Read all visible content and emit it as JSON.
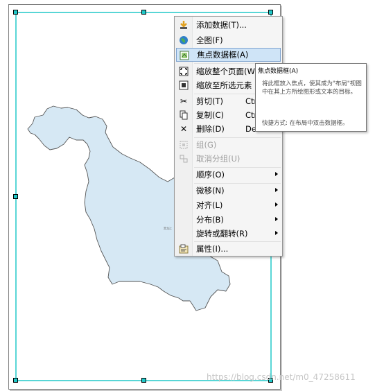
{
  "menu": {
    "items": [
      {
        "label": "添加数据(T)...",
        "icon": "add-data-icon",
        "shortcut": "",
        "disabled": false,
        "submenu": false,
        "highlighted": false
      },
      {
        "label": "全图(F)",
        "icon": "globe-icon",
        "shortcut": "",
        "disabled": false,
        "submenu": false,
        "highlighted": false
      },
      {
        "label": "焦点数据框(A)",
        "icon": "focus-frame-icon",
        "shortcut": "",
        "disabled": false,
        "submenu": false,
        "highlighted": true
      },
      {
        "label": "缩放整个页面(W",
        "icon": "zoom-page-icon",
        "shortcut": "",
        "disabled": false,
        "submenu": false,
        "highlighted": false
      },
      {
        "label": "缩放至所选元素",
        "icon": "zoom-selected-icon",
        "shortcut": "",
        "disabled": false,
        "submenu": false,
        "highlighted": false
      },
      {
        "label": "剪切(T)",
        "icon": "scissors-icon",
        "shortcut": "Ctr",
        "disabled": false,
        "submenu": false,
        "highlighted": false
      },
      {
        "label": "复制(C)",
        "icon": "copy-icon",
        "shortcut": "Ctr",
        "disabled": false,
        "submenu": false,
        "highlighted": false
      },
      {
        "label": "删除(D)",
        "icon": "delete-icon",
        "shortcut": "De",
        "disabled": false,
        "submenu": false,
        "highlighted": false
      },
      {
        "label": "组(G)",
        "icon": "group-icon",
        "shortcut": "",
        "disabled": true,
        "submenu": false,
        "highlighted": false
      },
      {
        "label": "取消分组(U)",
        "icon": "ungroup-icon",
        "shortcut": "",
        "disabled": true,
        "submenu": false,
        "highlighted": false
      },
      {
        "label": "顺序(O)",
        "icon": "",
        "shortcut": "",
        "disabled": false,
        "submenu": true,
        "highlighted": false
      },
      {
        "label": "微移(N)",
        "icon": "",
        "shortcut": "",
        "disabled": false,
        "submenu": true,
        "highlighted": false
      },
      {
        "label": "对齐(L)",
        "icon": "",
        "shortcut": "",
        "disabled": false,
        "submenu": true,
        "highlighted": false
      },
      {
        "label": "分布(B)",
        "icon": "",
        "shortcut": "",
        "disabled": false,
        "submenu": true,
        "highlighted": false
      },
      {
        "label": "旋转或翻转(R)",
        "icon": "",
        "shortcut": "",
        "disabled": false,
        "submenu": true,
        "highlighted": false
      },
      {
        "label": "属性(I)...",
        "icon": "properties-icon",
        "shortcut": "",
        "disabled": false,
        "submenu": false,
        "highlighted": false
      }
    ]
  },
  "tooltip": {
    "title": "焦点数据框(A)",
    "body": "将此框放入焦点，使其成为\"布局\"视图中在其上方所绘图形或文本的目标。",
    "shortcut": "快捷方式: 在布局中双击数据框。"
  },
  "map": {
    "tiny_label": "黑龙江",
    "fill_color": "#d6e8f4",
    "selection_color": "#20c8c8"
  },
  "watermark": "https://blog.csdn.net/m0_47258611"
}
